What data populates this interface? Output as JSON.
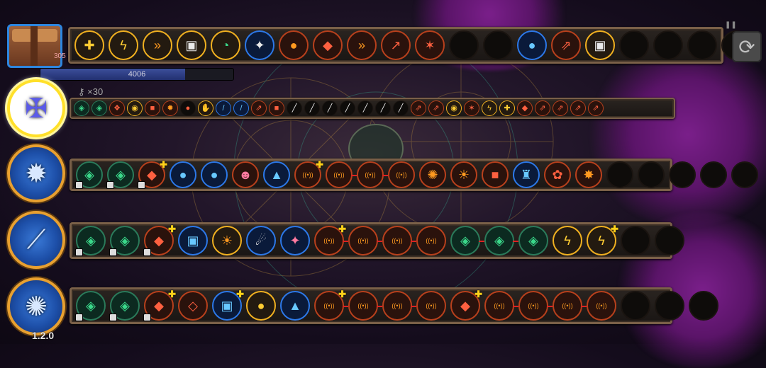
{
  "player": {
    "hp_value": "4006",
    "hp_fraction": 0.75,
    "chest_count": "305",
    "keys_label": "×30"
  },
  "version": "1.2.0",
  "colors": {
    "frame": "#7a6048",
    "gold_ring": "#f0b020",
    "blue_ring": "#2c78e8",
    "red_ring": "#b8401c",
    "selected": "#ffe02a"
  },
  "top_row": [
    {
      "icon": "gold-cross-icon",
      "ring": "gold",
      "glyph": "✚",
      "tint": "gold"
    },
    {
      "icon": "lightning-icon",
      "ring": "gold",
      "glyph": "ϟ",
      "tint": "gold"
    },
    {
      "icon": "speed-chevrons-icon",
      "ring": "gold",
      "glyph": "»",
      "tint": "orange"
    },
    {
      "icon": "card-icon",
      "ring": "gold",
      "glyph": "▣",
      "tint": "white"
    },
    {
      "icon": "gauge-icon",
      "ring": "gold",
      "glyph": "◔",
      "tint": "green"
    },
    {
      "icon": "star-burst-icon",
      "ring": "blue",
      "glyph": "✦",
      "tint": "white"
    },
    {
      "icon": "bread-icon",
      "ring": "red",
      "glyph": "●",
      "tint": "orange"
    },
    {
      "icon": "brick-icon",
      "ring": "red",
      "glyph": "◆",
      "tint": "red"
    },
    {
      "icon": "speed-chevrons-icon",
      "ring": "red",
      "glyph": "»",
      "tint": "orange"
    },
    {
      "icon": "arrow-up-icon",
      "ring": "red",
      "glyph": "↗",
      "tint": "red"
    },
    {
      "icon": "tri-arrows-icon",
      "ring": "red",
      "glyph": "✶",
      "tint": "red"
    },
    {
      "icon": "empty-slot",
      "ring": "plain",
      "glyph": "",
      "tint": ""
    },
    {
      "icon": "empty-slot",
      "ring": "plain",
      "glyph": "",
      "tint": ""
    },
    {
      "icon": "orb-icon",
      "ring": "blue",
      "glyph": "●",
      "tint": "blue"
    },
    {
      "icon": "double-arrow-icon",
      "ring": "red",
      "glyph": "⇗",
      "tint": "red"
    },
    {
      "icon": "card-icon",
      "ring": "gold",
      "glyph": "▣",
      "tint": "white"
    },
    {
      "icon": "empty-slot",
      "ring": "plain",
      "glyph": "",
      "tint": ""
    },
    {
      "icon": "empty-slot",
      "ring": "plain",
      "glyph": "",
      "tint": ""
    },
    {
      "icon": "empty-slot",
      "ring": "plain",
      "glyph": "",
      "tint": ""
    },
    {
      "icon": "empty-slot",
      "ring": "plain",
      "glyph": "",
      "tint": ""
    }
  ],
  "characters": [
    {
      "name": "staff-hero",
      "weapon": "✠",
      "selected": true
    },
    {
      "name": "mace-hero",
      "weapon": "✹",
      "selected": false
    },
    {
      "name": "blade-hero",
      "weapon": "⟋",
      "selected": false
    },
    {
      "name": "orb-hero",
      "weapon": "✺",
      "selected": false
    }
  ],
  "row1": [
    {
      "icon": "emerald-icon",
      "ring": "teal",
      "glyph": "◈",
      "tint": "green"
    },
    {
      "icon": "emerald-icon",
      "ring": "teal",
      "glyph": "◈",
      "tint": "green"
    },
    {
      "icon": "cluster-icon",
      "ring": "red",
      "glyph": "❖",
      "tint": "red"
    },
    {
      "icon": "eye-icon",
      "ring": "gold",
      "glyph": "◉",
      "tint": "gold"
    },
    {
      "icon": "box-icon",
      "ring": "red",
      "glyph": "■",
      "tint": "red"
    },
    {
      "icon": "flame-icon",
      "ring": "red",
      "glyph": "✹",
      "tint": "orange"
    },
    {
      "icon": "dark-blob-icon",
      "ring": "plain",
      "glyph": "●",
      "tint": "red"
    },
    {
      "icon": "glove-icon",
      "ring": "gold",
      "glyph": "✋",
      "tint": "white"
    },
    {
      "icon": "slash-icon",
      "ring": "blue",
      "glyph": "/",
      "tint": "blue"
    },
    {
      "icon": "slash-icon",
      "ring": "blue",
      "glyph": "/",
      "tint": "blue"
    },
    {
      "icon": "double-arrow-icon",
      "ring": "red",
      "glyph": "⇗",
      "tint": "red"
    },
    {
      "icon": "box-icon",
      "ring": "red",
      "glyph": "■",
      "tint": "red"
    },
    {
      "icon": "locked-slot",
      "ring": "plain",
      "glyph": "╱",
      "tint": "white"
    },
    {
      "icon": "locked-slot",
      "ring": "plain",
      "glyph": "╱",
      "tint": "white"
    },
    {
      "icon": "locked-slot",
      "ring": "plain",
      "glyph": "╱",
      "tint": "white"
    },
    {
      "icon": "locked-slot",
      "ring": "plain",
      "glyph": "╱",
      "tint": "white"
    },
    {
      "icon": "locked-slot",
      "ring": "plain",
      "glyph": "╱",
      "tint": "white"
    },
    {
      "icon": "locked-slot",
      "ring": "plain",
      "glyph": "╱",
      "tint": "white"
    },
    {
      "icon": "locked-slot",
      "ring": "plain",
      "glyph": "╱",
      "tint": "white"
    },
    {
      "icon": "double-arrow-icon",
      "ring": "red",
      "glyph": "⇗",
      "tint": "red"
    },
    {
      "icon": "double-arrow-icon",
      "ring": "red",
      "glyph": "⇗",
      "tint": "red"
    },
    {
      "icon": "eye-icon",
      "ring": "gold",
      "glyph": "◉",
      "tint": "gold"
    },
    {
      "icon": "tri-arrows-icon",
      "ring": "red",
      "glyph": "✶",
      "tint": "red"
    },
    {
      "icon": "bolt-icon",
      "ring": "gold",
      "glyph": "ϟ",
      "tint": "gold"
    },
    {
      "icon": "gold-cross-icon",
      "ring": "gold",
      "glyph": "✚",
      "tint": "gold"
    },
    {
      "icon": "brick-icon",
      "ring": "red",
      "glyph": "◆",
      "tint": "red"
    },
    {
      "icon": "double-arrow-icon",
      "ring": "red",
      "glyph": "⇗",
      "tint": "red"
    },
    {
      "icon": "double-arrow-icon",
      "ring": "red",
      "glyph": "⇗",
      "tint": "red"
    },
    {
      "icon": "double-arrow-icon",
      "ring": "red",
      "glyph": "⇗",
      "tint": "red"
    },
    {
      "icon": "double-arrow-icon",
      "ring": "red",
      "glyph": "⇗",
      "tint": "red"
    }
  ],
  "row2": [
    {
      "icon": "emerald-icon",
      "ring": "teal",
      "glyph": "◈",
      "tint": "green",
      "lock": true
    },
    {
      "icon": "emerald-icon",
      "ring": "teal",
      "glyph": "◈",
      "tint": "green",
      "lock": true
    },
    {
      "icon": "rock-icon",
      "ring": "red",
      "glyph": "◆",
      "tint": "red",
      "lock": true,
      "plus": true
    },
    {
      "icon": "jelly-icon",
      "ring": "blue",
      "glyph": "●",
      "tint": "blue"
    },
    {
      "icon": "jelly-icon",
      "ring": "blue",
      "glyph": "●",
      "tint": "blue"
    },
    {
      "icon": "spirit-icon",
      "ring": "red",
      "glyph": "☻",
      "tint": "pink"
    },
    {
      "icon": "crystal-icon",
      "ring": "blue",
      "glyph": "▲",
      "tint": "blue"
    },
    {
      "icon": "signal-icon",
      "ring": "red",
      "glyph": "((•))",
      "tint": "orange",
      "plus": true
    },
    {
      "icon": "signal-icon",
      "ring": "red",
      "glyph": "((•))",
      "tint": "orange",
      "link": true
    },
    {
      "icon": "signal-icon",
      "ring": "red",
      "glyph": "((•))",
      "tint": "orange",
      "link": true
    },
    {
      "icon": "signal-icon",
      "ring": "red",
      "glyph": "((•))",
      "tint": "orange"
    },
    {
      "icon": "sun-gear-icon",
      "ring": "red",
      "glyph": "✺",
      "tint": "orange"
    },
    {
      "icon": "sun-icon",
      "ring": "red",
      "glyph": "☀",
      "tint": "orange"
    },
    {
      "icon": "box-icon",
      "ring": "red",
      "glyph": "■",
      "tint": "red"
    },
    {
      "icon": "beacon-icon",
      "ring": "blue",
      "glyph": "♜",
      "tint": "blue"
    },
    {
      "icon": "flower-icon",
      "ring": "red",
      "glyph": "✿",
      "tint": "red"
    },
    {
      "icon": "burst-icon",
      "ring": "red",
      "glyph": "✸",
      "tint": "orange"
    },
    {
      "icon": "empty-slot",
      "ring": "plain",
      "glyph": "",
      "tint": ""
    },
    {
      "icon": "empty-slot",
      "ring": "plain",
      "glyph": "",
      "tint": ""
    },
    {
      "icon": "empty-slot",
      "ring": "plain",
      "glyph": "",
      "tint": ""
    },
    {
      "icon": "empty-slot",
      "ring": "plain",
      "glyph": "",
      "tint": ""
    },
    {
      "icon": "empty-slot",
      "ring": "plain",
      "glyph": "",
      "tint": ""
    }
  ],
  "row3": [
    {
      "icon": "emerald-icon",
      "ring": "teal",
      "glyph": "◈",
      "tint": "green",
      "lock": true
    },
    {
      "icon": "emerald-icon",
      "ring": "teal",
      "glyph": "◈",
      "tint": "green",
      "lock": true
    },
    {
      "icon": "rock-icon",
      "ring": "red",
      "glyph": "◆",
      "tint": "red",
      "lock": true,
      "plus": true
    },
    {
      "icon": "spiral-icon",
      "ring": "blue",
      "glyph": "▣",
      "tint": "blue"
    },
    {
      "icon": "sun-icon",
      "ring": "gold",
      "glyph": "☀",
      "tint": "orange"
    },
    {
      "icon": "comet-icon",
      "ring": "blue",
      "glyph": "☄",
      "tint": "white"
    },
    {
      "icon": "star-cross-icon",
      "ring": "blue",
      "glyph": "✦",
      "tint": "pink"
    },
    {
      "icon": "signal-icon",
      "ring": "red",
      "glyph": "((•))",
      "tint": "orange",
      "plus": true,
      "link": true
    },
    {
      "icon": "signal-icon",
      "ring": "red",
      "glyph": "((•))",
      "tint": "orange",
      "link": true
    },
    {
      "icon": "signal-icon",
      "ring": "red",
      "glyph": "((•))",
      "tint": "orange",
      "link": true
    },
    {
      "icon": "signal-icon",
      "ring": "red",
      "glyph": "((•))",
      "tint": "orange"
    },
    {
      "icon": "emerald-icon",
      "ring": "teal",
      "glyph": "◈",
      "tint": "green",
      "link": true
    },
    {
      "icon": "emerald-icon",
      "ring": "teal",
      "glyph": "◈",
      "tint": "green",
      "link": true
    },
    {
      "icon": "emerald-icon",
      "ring": "teal",
      "glyph": "◈",
      "tint": "green"
    },
    {
      "icon": "claw-icon",
      "ring": "gold",
      "glyph": "ϟ",
      "tint": "gold"
    },
    {
      "icon": "claw-icon",
      "ring": "gold",
      "glyph": "ϟ",
      "tint": "gold",
      "plus": true
    },
    {
      "icon": "empty-slot",
      "ring": "plain",
      "glyph": "",
      "tint": ""
    },
    {
      "icon": "empty-slot",
      "ring": "plain",
      "glyph": "",
      "tint": ""
    }
  ],
  "row4": [
    {
      "icon": "emerald-icon",
      "ring": "teal",
      "glyph": "◈",
      "tint": "green",
      "lock": true
    },
    {
      "icon": "emerald-icon",
      "ring": "teal",
      "glyph": "◈",
      "tint": "green",
      "lock": true
    },
    {
      "icon": "rock-icon",
      "ring": "red",
      "glyph": "◆",
      "tint": "red",
      "lock": true,
      "plus": true
    },
    {
      "icon": "diamond-icon",
      "ring": "red",
      "glyph": "◇",
      "tint": "red"
    },
    {
      "icon": "spiral-icon",
      "ring": "blue",
      "glyph": "▣",
      "tint": "blue",
      "plus": true
    },
    {
      "icon": "bread-icon",
      "ring": "gold",
      "glyph": "●",
      "tint": "gold"
    },
    {
      "icon": "crystal-icon",
      "ring": "blue",
      "glyph": "▲",
      "tint": "blue"
    },
    {
      "icon": "signal-icon",
      "ring": "red",
      "glyph": "((•))",
      "tint": "orange",
      "plus": true,
      "link": true
    },
    {
      "icon": "signal-icon",
      "ring": "red",
      "glyph": "((•))",
      "tint": "orange",
      "link": true
    },
    {
      "icon": "signal-icon",
      "ring": "red",
      "glyph": "((•))",
      "tint": "orange",
      "link": true
    },
    {
      "icon": "signal-icon",
      "ring": "red",
      "glyph": "((•))",
      "tint": "orange"
    },
    {
      "icon": "rock-icon",
      "ring": "red",
      "glyph": "◆",
      "tint": "red",
      "plus": true
    },
    {
      "icon": "signal-icon",
      "ring": "red",
      "glyph": "((•))",
      "tint": "orange",
      "link": true
    },
    {
      "icon": "signal-icon",
      "ring": "red",
      "glyph": "((•))",
      "tint": "orange",
      "link": true
    },
    {
      "icon": "signal-icon",
      "ring": "red",
      "glyph": "((•))",
      "tint": "orange",
      "link": true
    },
    {
      "icon": "signal-icon",
      "ring": "red",
      "glyph": "((•))",
      "tint": "orange"
    },
    {
      "icon": "empty-slot",
      "ring": "plain",
      "glyph": "",
      "tint": ""
    },
    {
      "icon": "empty-slot",
      "ring": "plain",
      "glyph": "",
      "tint": ""
    },
    {
      "icon": "empty-slot",
      "ring": "plain",
      "glyph": "",
      "tint": ""
    }
  ]
}
